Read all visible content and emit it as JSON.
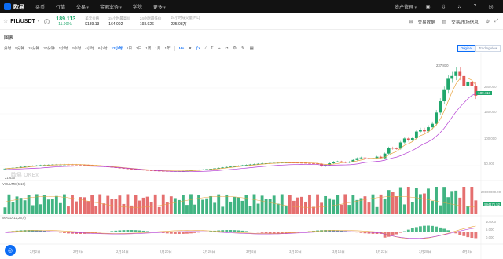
{
  "nav": {
    "logo": "欧易",
    "items": [
      {
        "label": "买币",
        "arrow": false
      },
      {
        "label": "行情",
        "arrow": false
      },
      {
        "label": "交易",
        "arrow": true
      },
      {
        "label": "金融业务",
        "arrow": true
      },
      {
        "label": "学院",
        "arrow": false
      },
      {
        "label": "更多",
        "arrow": true,
        "badge": "new"
      }
    ],
    "right_item": "资产管理",
    "right_icons": [
      "user-icon",
      "download-icon",
      "bell-icon",
      "question-icon",
      "globe-icon"
    ]
  },
  "ticker": {
    "pair": "FIL/USDT",
    "last_price": "189.113",
    "change": "+11.90%",
    "stats": [
      {
        "label": "美元价格",
        "value": "$189.13"
      },
      {
        "label": "24小时最高价",
        "value": "164.002"
      },
      {
        "label": "24小时最低价",
        "value": "193.926"
      },
      {
        "label": "24小时成交量(FIL)",
        "value": "225.08万"
      }
    ],
    "right": {
      "trade_data": "交易数据",
      "trade_info": "交易/市场信息"
    }
  },
  "section_title": "图表",
  "toolbar": {
    "timeframes": [
      "分时",
      "5分钟",
      "15分钟",
      "30分钟",
      "1小时",
      "2小时",
      "4小时",
      "6小时",
      "12小时",
      "1日",
      "3日",
      "1周",
      "1月",
      "1年"
    ],
    "active_timeframe": "12小时",
    "indicator": "MA",
    "view_original": "Original",
    "view_tradingview": "TradingView"
  },
  "chart": {
    "high_label": "237.810",
    "low_label": "21.630",
    "current_price": "189.113",
    "volume_legend": "VOLUME(5,10)",
    "volume_value": "594171.52",
    "macd_legend": "MACD(12,26,9)",
    "watermark": "欧易 OKEx",
    "price_axis": [
      "250.000",
      "200.000",
      "150.000",
      "100.000",
      "50.000"
    ],
    "volume_axis": [
      "20000000.00",
      "10000000.00"
    ],
    "macd_axis": [
      "10.000",
      "5.000",
      "0.000",
      "-5.000"
    ],
    "x_labels": [
      "2月2日",
      "2月9日",
      "2月14日",
      "2月20日",
      "2月26日",
      "3月4日",
      "3月10日",
      "3月16日",
      "3月22日",
      "3月28日",
      "4月3日"
    ]
  },
  "colors": {
    "up": "#20a76c",
    "down": "#e05656",
    "accent": "#0b6cf5",
    "ma5": "#e8a33d",
    "ma10": "#b43cd3"
  }
}
